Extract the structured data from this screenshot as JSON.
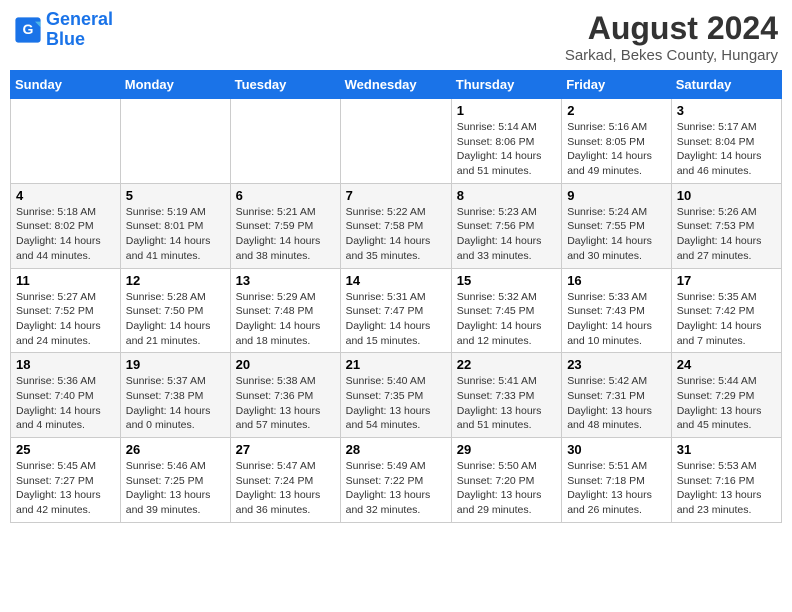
{
  "header": {
    "logo_line1": "General",
    "logo_line2": "Blue",
    "main_title": "August 2024",
    "sub_title": "Sarkad, Bekes County, Hungary"
  },
  "days_of_week": [
    "Sunday",
    "Monday",
    "Tuesday",
    "Wednesday",
    "Thursday",
    "Friday",
    "Saturday"
  ],
  "weeks": [
    [
      {
        "day": "",
        "info": ""
      },
      {
        "day": "",
        "info": ""
      },
      {
        "day": "",
        "info": ""
      },
      {
        "day": "",
        "info": ""
      },
      {
        "day": "1",
        "info": "Sunrise: 5:14 AM\nSunset: 8:06 PM\nDaylight: 14 hours and 51 minutes."
      },
      {
        "day": "2",
        "info": "Sunrise: 5:16 AM\nSunset: 8:05 PM\nDaylight: 14 hours and 49 minutes."
      },
      {
        "day": "3",
        "info": "Sunrise: 5:17 AM\nSunset: 8:04 PM\nDaylight: 14 hours and 46 minutes."
      }
    ],
    [
      {
        "day": "4",
        "info": "Sunrise: 5:18 AM\nSunset: 8:02 PM\nDaylight: 14 hours and 44 minutes."
      },
      {
        "day": "5",
        "info": "Sunrise: 5:19 AM\nSunset: 8:01 PM\nDaylight: 14 hours and 41 minutes."
      },
      {
        "day": "6",
        "info": "Sunrise: 5:21 AM\nSunset: 7:59 PM\nDaylight: 14 hours and 38 minutes."
      },
      {
        "day": "7",
        "info": "Sunrise: 5:22 AM\nSunset: 7:58 PM\nDaylight: 14 hours and 35 minutes."
      },
      {
        "day": "8",
        "info": "Sunrise: 5:23 AM\nSunset: 7:56 PM\nDaylight: 14 hours and 33 minutes."
      },
      {
        "day": "9",
        "info": "Sunrise: 5:24 AM\nSunset: 7:55 PM\nDaylight: 14 hours and 30 minutes."
      },
      {
        "day": "10",
        "info": "Sunrise: 5:26 AM\nSunset: 7:53 PM\nDaylight: 14 hours and 27 minutes."
      }
    ],
    [
      {
        "day": "11",
        "info": "Sunrise: 5:27 AM\nSunset: 7:52 PM\nDaylight: 14 hours and 24 minutes."
      },
      {
        "day": "12",
        "info": "Sunrise: 5:28 AM\nSunset: 7:50 PM\nDaylight: 14 hours and 21 minutes."
      },
      {
        "day": "13",
        "info": "Sunrise: 5:29 AM\nSunset: 7:48 PM\nDaylight: 14 hours and 18 minutes."
      },
      {
        "day": "14",
        "info": "Sunrise: 5:31 AM\nSunset: 7:47 PM\nDaylight: 14 hours and 15 minutes."
      },
      {
        "day": "15",
        "info": "Sunrise: 5:32 AM\nSunset: 7:45 PM\nDaylight: 14 hours and 12 minutes."
      },
      {
        "day": "16",
        "info": "Sunrise: 5:33 AM\nSunset: 7:43 PM\nDaylight: 14 hours and 10 minutes."
      },
      {
        "day": "17",
        "info": "Sunrise: 5:35 AM\nSunset: 7:42 PM\nDaylight: 14 hours and 7 minutes."
      }
    ],
    [
      {
        "day": "18",
        "info": "Sunrise: 5:36 AM\nSunset: 7:40 PM\nDaylight: 14 hours and 4 minutes."
      },
      {
        "day": "19",
        "info": "Sunrise: 5:37 AM\nSunset: 7:38 PM\nDaylight: 14 hours and 0 minutes."
      },
      {
        "day": "20",
        "info": "Sunrise: 5:38 AM\nSunset: 7:36 PM\nDaylight: 13 hours and 57 minutes."
      },
      {
        "day": "21",
        "info": "Sunrise: 5:40 AM\nSunset: 7:35 PM\nDaylight: 13 hours and 54 minutes."
      },
      {
        "day": "22",
        "info": "Sunrise: 5:41 AM\nSunset: 7:33 PM\nDaylight: 13 hours and 51 minutes."
      },
      {
        "day": "23",
        "info": "Sunrise: 5:42 AM\nSunset: 7:31 PM\nDaylight: 13 hours and 48 minutes."
      },
      {
        "day": "24",
        "info": "Sunrise: 5:44 AM\nSunset: 7:29 PM\nDaylight: 13 hours and 45 minutes."
      }
    ],
    [
      {
        "day": "25",
        "info": "Sunrise: 5:45 AM\nSunset: 7:27 PM\nDaylight: 13 hours and 42 minutes."
      },
      {
        "day": "26",
        "info": "Sunrise: 5:46 AM\nSunset: 7:25 PM\nDaylight: 13 hours and 39 minutes."
      },
      {
        "day": "27",
        "info": "Sunrise: 5:47 AM\nSunset: 7:24 PM\nDaylight: 13 hours and 36 minutes."
      },
      {
        "day": "28",
        "info": "Sunrise: 5:49 AM\nSunset: 7:22 PM\nDaylight: 13 hours and 32 minutes."
      },
      {
        "day": "29",
        "info": "Sunrise: 5:50 AM\nSunset: 7:20 PM\nDaylight: 13 hours and 29 minutes."
      },
      {
        "day": "30",
        "info": "Sunrise: 5:51 AM\nSunset: 7:18 PM\nDaylight: 13 hours and 26 minutes."
      },
      {
        "day": "31",
        "info": "Sunrise: 5:53 AM\nSunset: 7:16 PM\nDaylight: 13 hours and 23 minutes."
      }
    ]
  ]
}
